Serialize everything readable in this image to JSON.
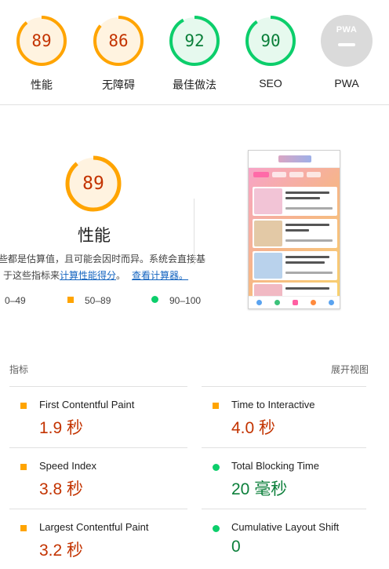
{
  "categories": [
    {
      "label": "性能",
      "score": "89",
      "fraction": 0.89,
      "status": "average"
    },
    {
      "label": "无障碍",
      "score": "86",
      "fraction": 0.86,
      "status": "average"
    },
    {
      "label": "最佳做法",
      "score": "92",
      "fraction": 0.92,
      "status": "pass"
    },
    {
      "label": "SEO",
      "score": "90",
      "fraction": 0.9,
      "status": "pass"
    },
    {
      "label": "PWA",
      "badge": "PWA",
      "status": "na"
    }
  ],
  "performance": {
    "score": "89",
    "fraction": 0.89,
    "title": "性能",
    "desc_line1": "些都是估算值，且可能会因时而异。系统会直接基",
    "desc_line2_prefix": "于这些指标来",
    "desc_link1": "计算性能得分",
    "desc_mid": "。",
    "desc_link2": "查看计算器。"
  },
  "legend": {
    "fail": "0–49",
    "average": "50–89",
    "pass": "90–100"
  },
  "metrics_header": {
    "label": "指标",
    "expand": "展开视图"
  },
  "metrics": [
    {
      "name": "First Contentful Paint",
      "value": "1.9 秒",
      "status": "average"
    },
    {
      "name": "Time to Interactive",
      "value": "4.0 秒",
      "status": "average"
    },
    {
      "name": "Speed Index",
      "value": "3.8 秒",
      "status": "average"
    },
    {
      "name": "Total Blocking Time",
      "value": "20 毫秒",
      "status": "pass"
    },
    {
      "name": "Largest Contentful Paint",
      "value": "3.2 秒",
      "status": "average"
    },
    {
      "name": "Cumulative Layout Shift",
      "value": "0",
      "status": "pass"
    }
  ],
  "colors": {
    "average": "#ffa400",
    "average_text": "#c33300",
    "pass": "#0cce6b",
    "pass_text": "#0b7f3a",
    "na": "#dadada",
    "link": "#1565c0"
  }
}
